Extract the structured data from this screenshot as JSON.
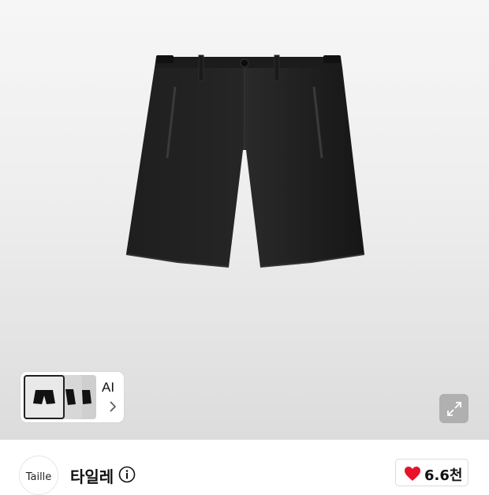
{
  "hero": {
    "product_image": "black-leather-shorts",
    "thumbnail_card": {
      "label": "AI",
      "thumbnail_count": 3
    },
    "expand_icon": "expand-arrows-icon"
  },
  "brand": {
    "logo_text": "Taille",
    "name": "타일레",
    "info_icon": "info-icon"
  },
  "like": {
    "icon": "heart-icon",
    "count": "6.6천",
    "color": "#e8122a"
  }
}
